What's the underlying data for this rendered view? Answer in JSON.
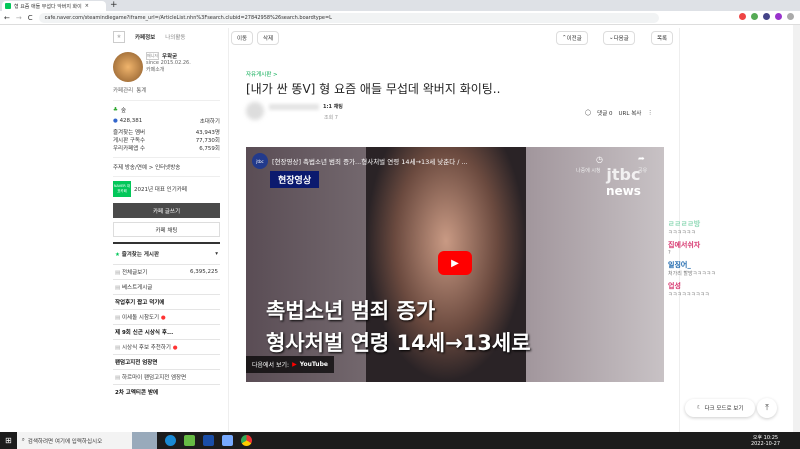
{
  "browser": {
    "tab_title": "형 요즘 애들 무섭다 악버지 화이",
    "url": "cafe.naver.com/steamindiegame?iframe_url=/ArticleList.nhn%3Fsearch.clubid=27842958%26search.boardtype=L"
  },
  "sidebar": {
    "tab_info": "카페정보",
    "tab_activity": "나의활동",
    "manager_badge": "매니저",
    "manager": "우왁굳",
    "since": "since 2015.02.26.",
    "intro": "카페소개",
    "manage": "카페관리",
    "stats": "통계",
    "level": "숲",
    "members": "428,381",
    "invite": "초대하기",
    "fav_members_label": "즐겨찾는 멤버",
    "fav_members": "43,943명",
    "board_sub_label": "게시판 구독수",
    "board_sub": "77,730회",
    "rep_label": "우리카페앱 수",
    "rep": "6,759회",
    "theme": "주제  방송/연예 > 인터넷방송",
    "award": "2021년 대표 인기카페",
    "naver_badge": "NAVER 대표카페",
    "write": "카페 글쓰기",
    "chat": "카페 채팅",
    "fav_boards": "즐겨찾는 게시판",
    "boards": [
      {
        "label": "전체글보기",
        "count": "6,395,225",
        "bold": false
      },
      {
        "label": "베스트게시글",
        "bold": false
      },
      {
        "label": "작업후기 짭고 덕기에",
        "bold": true
      },
      {
        "label": "이세돌 시참도기",
        "bold": false,
        "new": true
      },
      {
        "label": "제 9회 신곤 시상식 후...",
        "bold": true
      },
      {
        "label": "시상식 후보 추천하기",
        "bold": false,
        "new": true
      },
      {
        "label": "팬덤고지전 엄장면",
        "bold": true
      },
      {
        "label": "하르마이 팬덤고지전 엠장면",
        "bold": false
      },
      {
        "label": "2차 고멕티콘 받에",
        "bold": true
      }
    ]
  },
  "toolbar": {
    "move": "이동",
    "delete": "삭제",
    "prev": "이전글",
    "next": "다음글",
    "list": "목록"
  },
  "article": {
    "board": "자유게시판 >",
    "title": "[내가 싼 똥ᐯ] 형 요즘 애들 무섭데 왁버지 화이팅..",
    "chat_badge": "1:1 채팅",
    "views": "조회 7",
    "comments": "댓글 0",
    "url_copy": "URL 복사"
  },
  "video": {
    "title": "[현장영상] 촉법소년 범죄 증가...형사처벌 연령 14세→13세 낮춘다 / ...",
    "later": "나중에 시청",
    "share": "공유",
    "label": "현장영상",
    "caption1": "촉법소년 범죄 증가",
    "caption2": "형사처벌 연령 14세→13세로",
    "watch_on": "다음에서 보기:",
    "youtube": "YouTube",
    "brand": "jtbc",
    "news": "news"
  },
  "chat": [
    {
      "name": "ㄹㄹㄹㄹ방",
      "msg": "ㅋㅋㅋㅋㅋㅋ",
      "color": "#8fd9b6"
    },
    {
      "name": "집에서쉬자",
      "msg": "?",
      "color": "#d6336c"
    },
    {
      "name": "일징어_",
      "msg": "처가리 할방ㅋㅋㅋㅋㅋ",
      "color": "#1864ab"
    },
    {
      "name": "업성",
      "msg": "ㅋㅋㅋㅋㅋㅋㅋㅋㅋ",
      "color": "#d6336c"
    }
  ],
  "dark_mode": "다크 모드로 보기",
  "taskbar": {
    "search": "검색하려면 여기에 입력하십시오",
    "time": "오후 10:25",
    "date": "2022-10-27"
  }
}
